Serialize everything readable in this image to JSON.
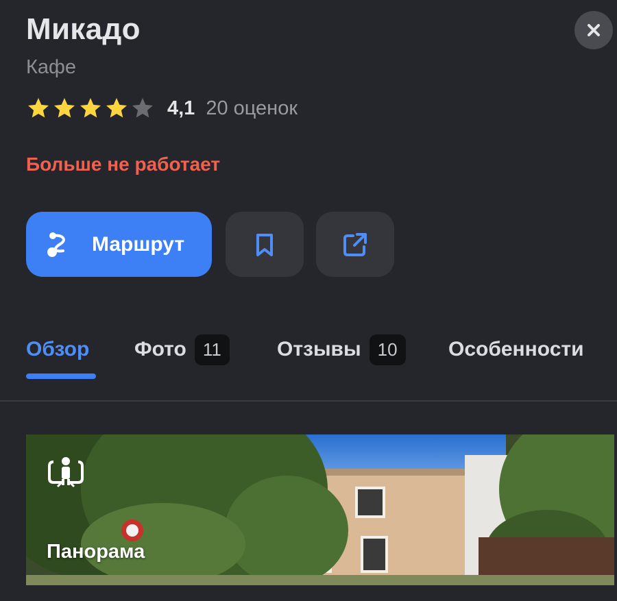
{
  "header": {
    "title": "Микадо",
    "category": "Кафе"
  },
  "rating": {
    "stars_filled": 4,
    "stars_total": 5,
    "value": "4,1",
    "count_text": "20 оценок"
  },
  "status": {
    "closed_text": "Больше не работает",
    "color": "#f0614f"
  },
  "actions": {
    "route_label": "Маршрут",
    "route_icon": "route-icon",
    "bookmark_icon": "bookmark-icon",
    "share_icon": "share-icon",
    "accent": "#3d7ff5"
  },
  "tabs": [
    {
      "label": "Обзор",
      "badge": "",
      "active": true
    },
    {
      "label": "Фото",
      "badge": "11",
      "active": false
    },
    {
      "label": "Отзывы",
      "badge": "10",
      "active": false
    },
    {
      "label": "Особенности",
      "badge": "",
      "active": false
    }
  ],
  "panorama": {
    "label": "Панорама",
    "icon": "panorama-person-icon"
  },
  "close_icon": "close-icon"
}
